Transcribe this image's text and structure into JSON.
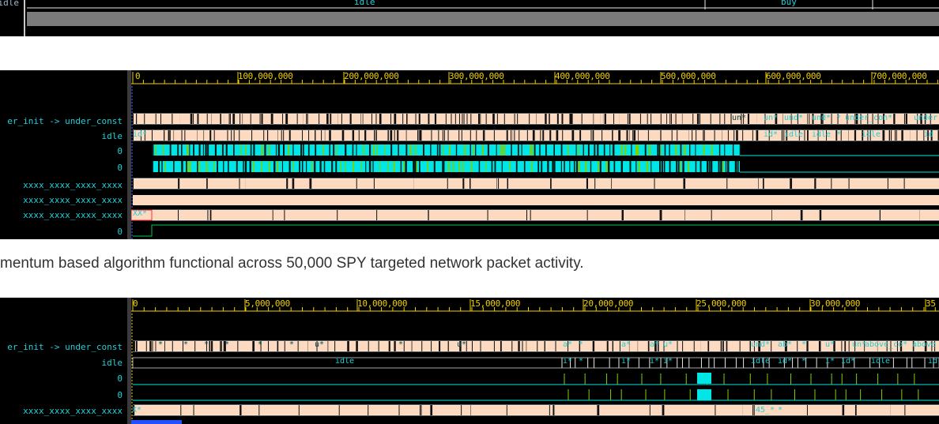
{
  "top_panel": {
    "signal_label": "idle",
    "bus_labels": [
      "idle",
      "buy"
    ]
  },
  "panel1": {
    "ruler_labels": [
      "0",
      "100,000,000",
      "200,000,000",
      "300,000,000",
      "400,000,000",
      "500,000,000",
      "600,000,000",
      "700,000,000"
    ],
    "signals": [
      "er_init -> under_const",
      "idle",
      "0",
      "0",
      "xxxx_xxxx_xxxx_xxxx",
      "xxxx_xxxx_xxxx_xxxx",
      "xxxx_xxxx_xxxx_xxxx",
      "0"
    ],
    "row0_labels": [
      "un*",
      "und*",
      "und*",
      "*",
      "under_con*",
      "under"
    ],
    "row1_labels": [
      "id*",
      "id*",
      "idle",
      "idle",
      "*",
      "idle",
      "id"
    ],
    "row6_labels": [
      "XX*"
    ]
  },
  "caption": "mentum based algorithm functional across 50,000 SPY targeted network packet activity.",
  "panel2": {
    "ruler_labels": [
      "0",
      "5,000,000",
      "10,000,000",
      "15,000,000",
      "20,000,000",
      "25,000,000",
      "30,000,000",
      "35"
    ],
    "signals": [
      "er_init -> under_const",
      "idle",
      "0",
      "0",
      "xxxx_xxxx_xxxx_xxxx"
    ],
    "row0_labels": [
      "*",
      "*",
      "*",
      "*",
      "*",
      "*",
      "u*",
      "*",
      "u*",
      "a*",
      "*",
      "a*",
      "a*",
      "u*",
      "und*",
      "ab*",
      "*",
      "u*",
      "un*",
      "above_co*",
      "above"
    ],
    "row1_labels": [
      "idle",
      "i*",
      "*",
      "i*",
      "i*",
      "i*",
      "idle",
      "id*",
      "*",
      "i*",
      "id*",
      "idle",
      "id"
    ],
    "row4_labels": [
      "X*",
      "45_*",
      "*"
    ]
  }
}
